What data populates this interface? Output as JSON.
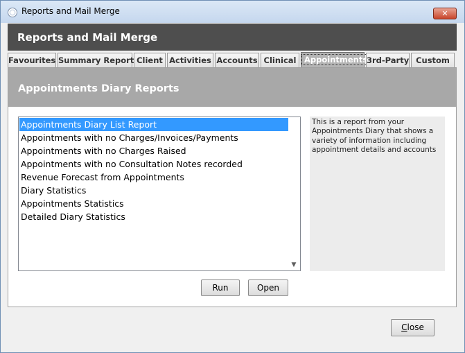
{
  "window": {
    "title": "Reports and Mail Merge",
    "close_glyph": "✕"
  },
  "header": {
    "title": "Reports and Mail Merge"
  },
  "tabs": [
    {
      "label": "Favourites",
      "active": false
    },
    {
      "label": "Summary Reports",
      "active": false
    },
    {
      "label": "Client",
      "active": false
    },
    {
      "label": "Activities",
      "active": false
    },
    {
      "label": "Accounts",
      "active": false
    },
    {
      "label": "Clinical",
      "active": false
    },
    {
      "label": "Appointments",
      "active": true
    },
    {
      "label": "3rd-Party",
      "active": false
    },
    {
      "label": "Custom",
      "active": false
    }
  ],
  "section": {
    "title": "Appointments Diary Reports"
  },
  "reports": {
    "selected_index": 0,
    "items": [
      "Appointments Diary List Report",
      "Appointments with no Charges/Invoices/Payments",
      "Appointments with no Charges Raised",
      "Appointments with no Consultation Notes recorded",
      "Revenue Forecast from Appointments",
      "Diary Statistics",
      "Appointments Statistics",
      "Detailed Diary Statistics"
    ]
  },
  "description": {
    "text": "This is a report from your Appointments Diary that shows a variety of information including appointment details and accounts"
  },
  "buttons": {
    "run": "Run",
    "open": "Open",
    "close_mnemonic": "C",
    "close_rest": "lose"
  },
  "colors": {
    "selection": "#3399ff",
    "header_bar": "#4e4e4e",
    "section_header": "#a8a8a8",
    "active_tab": "#b4b4b4"
  }
}
